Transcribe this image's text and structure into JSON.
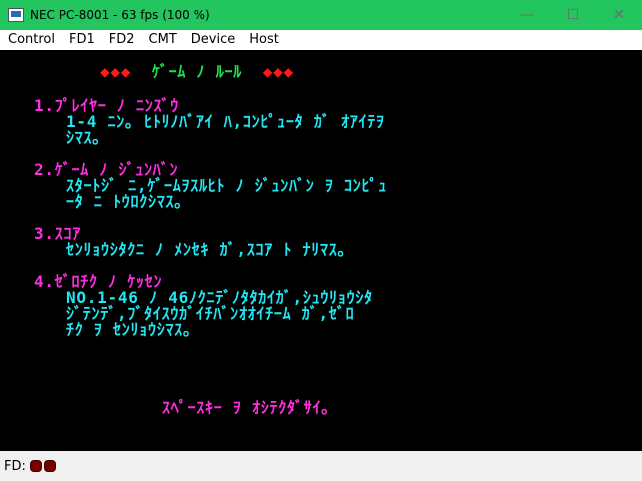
{
  "window": {
    "title": "NEC PC-8001 - 63 fps (100 %)",
    "minimize_glyph": "—",
    "maximize_glyph": "☐",
    "close_glyph": "✕"
  },
  "menu": [
    "Control",
    "FD1",
    "FD2",
    "CMT",
    "Device",
    "Host"
  ],
  "screen": {
    "heading_left": "◆◆◆",
    "heading_text": "ｹﾞｰﾑ ﾉ ﾙｰﾙ",
    "heading_right": "◆◆◆",
    "sections": [
      {
        "title": "1.ﾌﾟﾚｲﾔｰ ﾉ ﾆﾝｽﾞｳ",
        "lines": [
          "1-4 ﾆﾝ｡ ﾋﾄﾘﾉﾊﾞｱｲ ﾊ,ｺﾝﾋﾟｭｰﾀ ｶﾞ ｵｱｲﾃｦ",
          "ｼﾏｽ｡"
        ]
      },
      {
        "title": "2.ｹﾞｰﾑ ﾉ ｼﾞｭﾝﾊﾞﾝ",
        "lines": [
          "ｽﾀｰﾄｼﾞ ﾆ,ｹﾞｰﾑｦｽﾙﾋﾄ ﾉ ｼﾞｭﾝﾊﾞﾝ ｦ ｺﾝﾋﾟｭ",
          "ｰﾀ ﾆ ﾄｳﾛｸｼﾏｽ｡"
        ]
      },
      {
        "title": "3.ｽｺｱ",
        "lines": [
          "ｾﾝﾘｮｳｼﾀｸﾆ ﾉ ﾒﾝｾｷ ｶﾞ,ｽｺｱ ﾄ ﾅﾘﾏｽ｡"
        ]
      },
      {
        "title": "4.ｾﾞﾛﾁｸ ﾉ ｹｯｾﾝ",
        "lines": [
          "NO.1-46 ﾉ 46ﾉｸﾆﾃﾞﾉﾀﾀｶｲｶﾞ,ｼｭｳﾘｮｳｼﾀ",
          "ｼﾞﾃﾝﾃﾞ,ﾌﾞﾀｲｽｳｶﾞｲﾁﾊﾞﾝｵｵｲﾁｰﾑ ｶﾞ,ｾﾞﾛ",
          "ﾁｸ ｦ ｾﾝﾘｮｳｼﾏｽ｡"
        ]
      }
    ],
    "prompt": "ｽﾍﾟｰｽｷｰ ｦ ｵｼﾃｸﾀﾞｻｲ｡"
  },
  "status": {
    "label": "FD:",
    "drives": [
      "fd1",
      "fd2"
    ]
  },
  "colors": {
    "titlebar": "#22c55e",
    "magenta": "#ff2fe0",
    "cyan": "#23e6f2",
    "red": "#ff1a1a",
    "green": "#20e050",
    "fd_led": "#7a0000"
  }
}
